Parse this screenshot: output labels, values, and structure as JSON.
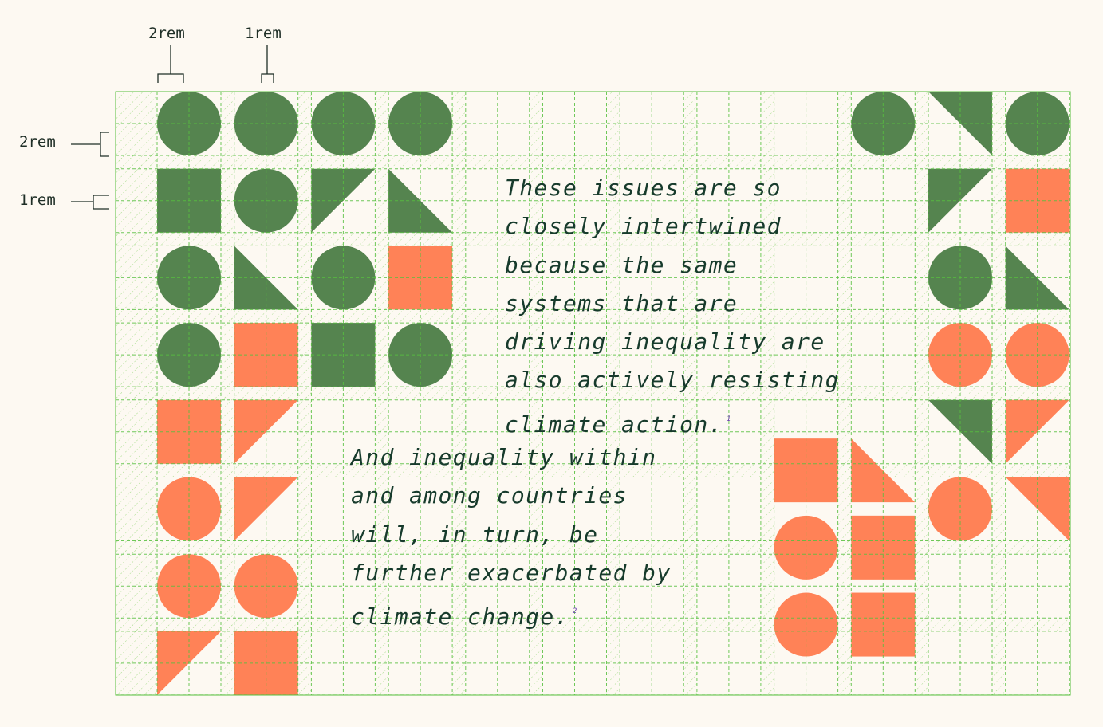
{
  "annotations": {
    "col_wide_label": "2rem",
    "col_narrow_label": "1rem",
    "row_tall_label": "2rem",
    "row_short_label": "1rem"
  },
  "colors": {
    "background": "#fdf9f2",
    "green": "#55844f",
    "orange": "#ff8257",
    "grid": "#57c03f",
    "text": "#173b2c",
    "footnote": "#6a3fb0"
  },
  "quote_one": {
    "lines": [
      "These issues are so",
      "closely intertwined",
      "because the same",
      "systems that are",
      "driving inequality are",
      "also actively resisting",
      "climate action."
    ],
    "footnote": "1"
  },
  "quote_two": {
    "lines": [
      "And inequality within",
      "and among countries",
      "will, in turn, be",
      "further exacerbated by",
      "climate change."
    ],
    "footnote": "2"
  },
  "shapes": [
    {
      "col": 0,
      "row": 0,
      "kind": "circle",
      "color": "green"
    },
    {
      "col": 1,
      "row": 0,
      "kind": "circle",
      "color": "green"
    },
    {
      "col": 2,
      "row": 0,
      "kind": "circle",
      "color": "green"
    },
    {
      "col": 3,
      "row": 0,
      "kind": "circle",
      "color": "green"
    },
    {
      "col": 9,
      "row": 0,
      "kind": "circle",
      "color": "green"
    },
    {
      "col": 10,
      "row": 0,
      "kind": "tri-tr",
      "color": "green"
    },
    {
      "col": 11,
      "row": 0,
      "kind": "circle",
      "color": "green"
    },
    {
      "col": 0,
      "row": 1,
      "kind": "square",
      "color": "green"
    },
    {
      "col": 1,
      "row": 1,
      "kind": "circle",
      "color": "green"
    },
    {
      "col": 2,
      "row": 1,
      "kind": "tri-tl",
      "color": "green"
    },
    {
      "col": 3,
      "row": 1,
      "kind": "tri-bl",
      "color": "green"
    },
    {
      "col": 10,
      "row": 1,
      "kind": "tri-tl",
      "color": "green"
    },
    {
      "col": 11,
      "row": 1,
      "kind": "square",
      "color": "orange"
    },
    {
      "col": 0,
      "row": 2,
      "kind": "circle",
      "color": "green"
    },
    {
      "col": 1,
      "row": 2,
      "kind": "tri-bl",
      "color": "green"
    },
    {
      "col": 2,
      "row": 2,
      "kind": "circle",
      "color": "green"
    },
    {
      "col": 3,
      "row": 2,
      "kind": "square",
      "color": "orange"
    },
    {
      "col": 10,
      "row": 2,
      "kind": "circle",
      "color": "green"
    },
    {
      "col": 11,
      "row": 2,
      "kind": "tri-bl",
      "color": "green"
    },
    {
      "col": 0,
      "row": 3,
      "kind": "circle",
      "color": "green"
    },
    {
      "col": 1,
      "row": 3,
      "kind": "square",
      "color": "orange"
    },
    {
      "col": 2,
      "row": 3,
      "kind": "square",
      "color": "green"
    },
    {
      "col": 3,
      "row": 3,
      "kind": "circle",
      "color": "green"
    },
    {
      "col": 10,
      "row": 3,
      "kind": "circle",
      "color": "orange"
    },
    {
      "col": 11,
      "row": 3,
      "kind": "circle",
      "color": "orange"
    },
    {
      "col": 0,
      "row": 4,
      "kind": "square",
      "color": "orange"
    },
    {
      "col": 1,
      "row": 4,
      "kind": "tri-tl",
      "color": "orange"
    },
    {
      "col": 10,
      "row": 4,
      "kind": "tri-tr",
      "color": "green"
    },
    {
      "col": 11,
      "row": 4,
      "kind": "tri-tl",
      "color": "orange"
    },
    {
      "col": 8,
      "row": 4.5,
      "kind": "square",
      "color": "orange"
    },
    {
      "col": 9,
      "row": 4.5,
      "kind": "tri-bl",
      "color": "orange"
    },
    {
      "col": 0,
      "row": 5,
      "kind": "circle",
      "color": "orange"
    },
    {
      "col": 1,
      "row": 5,
      "kind": "tri-tl",
      "color": "orange"
    },
    {
      "col": 10,
      "row": 5,
      "kind": "circle",
      "color": "orange"
    },
    {
      "col": 11,
      "row": 5,
      "kind": "tri-tr",
      "color": "orange"
    },
    {
      "col": 8,
      "row": 5.5,
      "kind": "circle",
      "color": "orange"
    },
    {
      "col": 9,
      "row": 5.5,
      "kind": "square",
      "color": "orange"
    },
    {
      "col": 0,
      "row": 6,
      "kind": "circle",
      "color": "orange"
    },
    {
      "col": 1,
      "row": 6,
      "kind": "circle",
      "color": "orange"
    },
    {
      "col": 8,
      "row": 6.5,
      "kind": "circle",
      "color": "orange"
    },
    {
      "col": 9,
      "row": 6.5,
      "kind": "square",
      "color": "orange"
    },
    {
      "col": 0,
      "row": 7,
      "kind": "tri-bl-up",
      "color": "orange"
    },
    {
      "col": 1,
      "row": 7,
      "kind": "square",
      "color": "orange"
    }
  ]
}
